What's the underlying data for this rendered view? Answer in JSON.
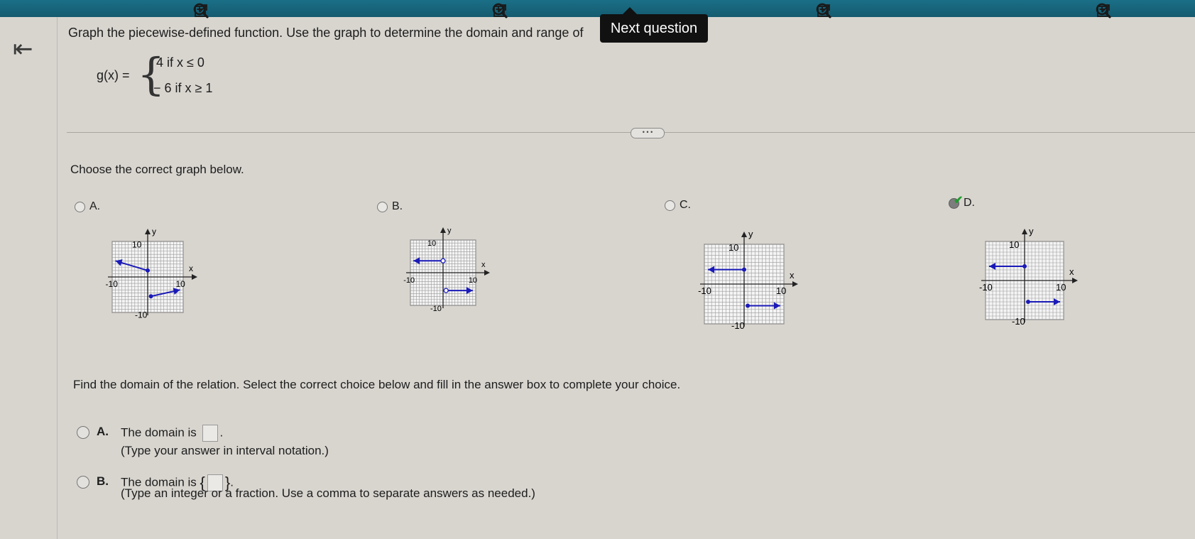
{
  "question": {
    "prompt": "Graph the piecewise-defined function. Use the graph to determine the domain and range of",
    "function_name": "g(x) =",
    "case1": "4  if x ≤ 0",
    "case2": "− 6  if x ≥ 1"
  },
  "tooltip": "Next question",
  "more_button": "• • •",
  "choose_text": "Choose the correct graph below.",
  "graph_options": [
    {
      "letter": "A.",
      "selected": false
    },
    {
      "letter": "B.",
      "selected": false
    },
    {
      "letter": "C.",
      "selected": false
    },
    {
      "letter": "D.",
      "selected": true
    }
  ],
  "graph_labels": {
    "y": "y",
    "x": "x",
    "ten": "10",
    "neg_ten": "-10"
  },
  "domain_question": "Find the domain of the relation. Select the correct choice below and fill in the answer box to complete your choice.",
  "answer_choices": [
    {
      "letter": "A.",
      "text_before": "The domain is",
      "text_after": ".",
      "hint": "(Type your answer in interval notation.)"
    },
    {
      "letter": "B.",
      "text_before": "The domain is",
      "text_after": ".",
      "hint": "(Type an integer or a fraction. Use a comma to separate answers as needed.)"
    }
  ],
  "icons": {
    "back": "collapse-left-icon",
    "zoom_in": "zoom-in-icon",
    "zoom_out": "zoom-out-icon",
    "popout": "popout-icon"
  },
  "colors": {
    "topbar": "#1a6f86",
    "series": "#1a1ab8",
    "check": "#1f9d2e"
  }
}
